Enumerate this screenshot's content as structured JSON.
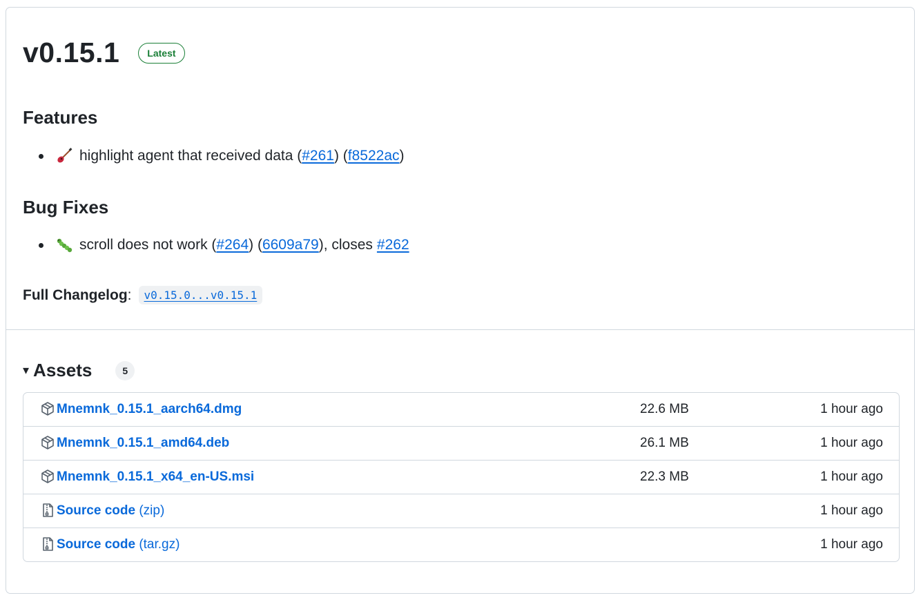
{
  "release": {
    "title": "v0.15.1",
    "badge": "Latest",
    "badge_color": "#1a7f37",
    "link_color": "#0969da"
  },
  "features": {
    "heading": "Features",
    "items": [
      {
        "emoji": "guitar-icon",
        "text": "highlight agent that received data (",
        "pr": "#261",
        "mid": ") (",
        "commit": "f8522ac",
        "end": ")"
      }
    ]
  },
  "bug_fixes": {
    "heading": "Bug Fixes",
    "items": [
      {
        "emoji": "caterpillar-icon",
        "text": "scroll does not work (",
        "pr": "#264",
        "mid": ") (",
        "commit": "6609a79",
        "closes_text": "), closes",
        "issue": "#262"
      }
    ]
  },
  "changelog": {
    "label": "Full Changelog",
    "colon": ":",
    "link": "v0.15.0...v0.15.1"
  },
  "assets": {
    "caret": "▾",
    "title": "Assets",
    "count": "5",
    "rows": [
      {
        "icon": "package-icon",
        "name": "Mnemnk_0.15.1_aarch64.dmg",
        "suffix": "",
        "size": "22.6 MB",
        "time": "1 hour ago"
      },
      {
        "icon": "package-icon",
        "name": "Mnemnk_0.15.1_amd64.deb",
        "suffix": "",
        "size": "26.1 MB",
        "time": "1 hour ago"
      },
      {
        "icon": "package-icon",
        "name": "Mnemnk_0.15.1_x64_en-US.msi",
        "suffix": "",
        "size": "22.3 MB",
        "time": "1 hour ago"
      },
      {
        "icon": "file-zip-icon",
        "name": "Source code",
        "suffix": "(zip)",
        "size": "",
        "time": "1 hour ago"
      },
      {
        "icon": "file-zip-icon",
        "name": "Source code",
        "suffix": "(tar.gz)",
        "size": "",
        "time": "1 hour ago"
      }
    ]
  }
}
